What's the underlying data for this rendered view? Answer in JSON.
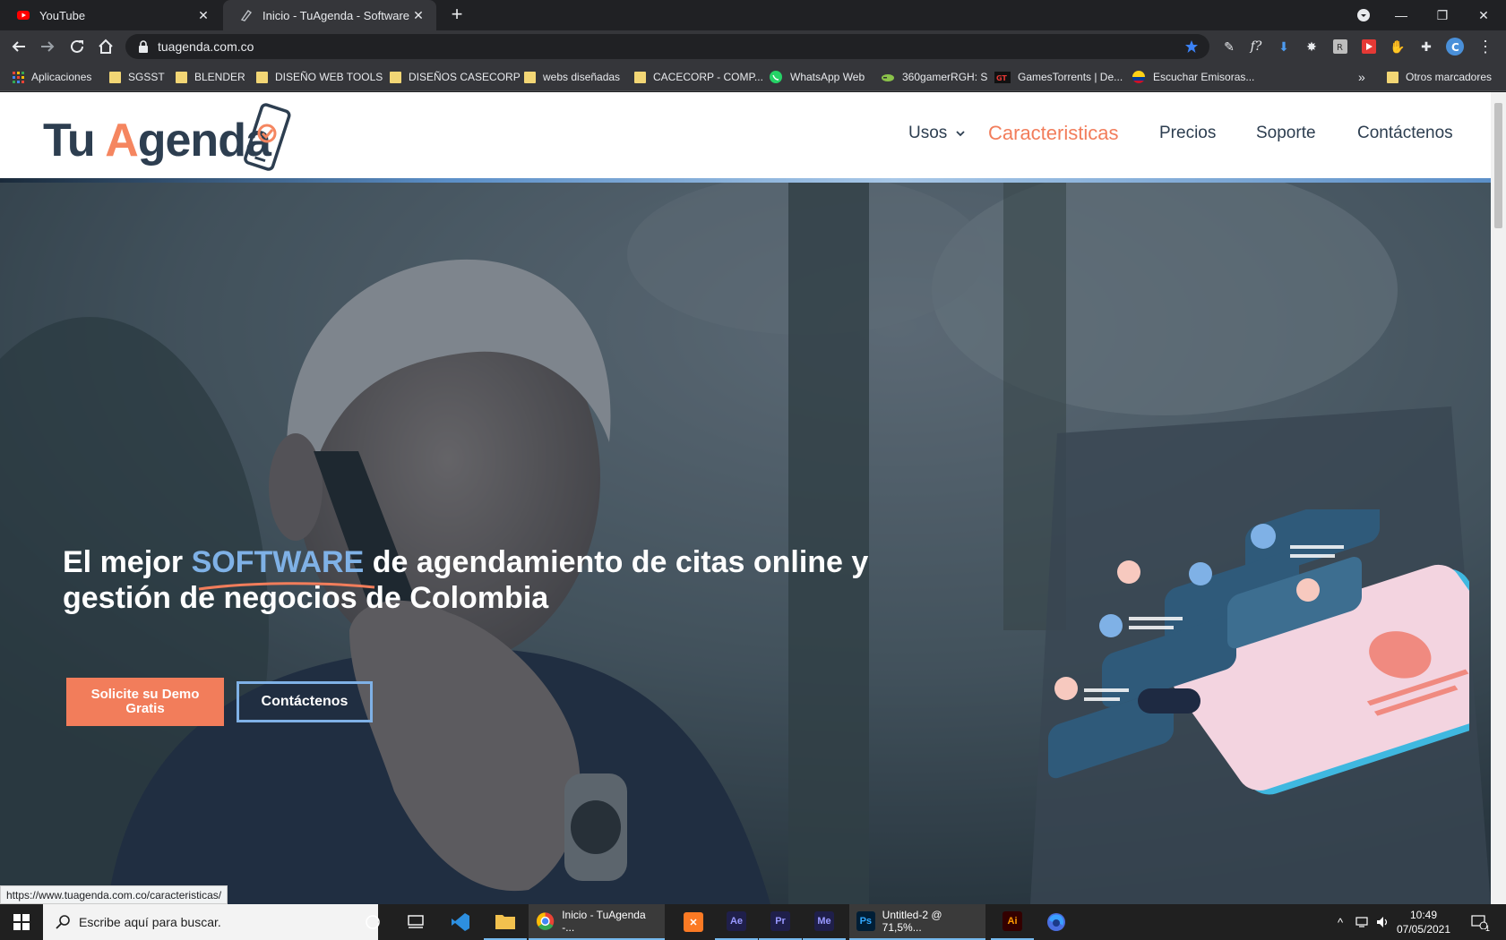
{
  "browser": {
    "tabs": [
      {
        "title": "YouTube",
        "icon": "youtube-icon"
      },
      {
        "title": "Inicio - TuAgenda - Software de ag",
        "icon": "page-icon",
        "active": true
      }
    ],
    "address": "tuagenda.com.co",
    "bookmarks": [
      {
        "label": "Aplicaciones",
        "icon": "apps-grid-icon"
      },
      {
        "label": "SGSST",
        "icon": "folder-icon"
      },
      {
        "label": "BLENDER",
        "icon": "folder-icon"
      },
      {
        "label": "DISEÑO WEB TOOLS",
        "icon": "folder-icon"
      },
      {
        "label": "DISEÑOS CASECORP",
        "icon": "folder-icon"
      },
      {
        "label": "webs diseñadas",
        "icon": "folder-icon"
      },
      {
        "label": "CACECORP - COMP...",
        "icon": "folder-icon"
      },
      {
        "label": "WhatsApp Web",
        "icon": "whatsapp-icon"
      },
      {
        "label": "360gamerRGH: S",
        "icon": "controller-icon"
      },
      {
        "label": "GamesTorrents | De...",
        "icon": "gt-icon"
      },
      {
        "label": "Escuchar Emisoras...",
        "icon": "colombia-flag-icon"
      }
    ],
    "bookmarks_overflow": "»",
    "other_bookmarks": "Otros marcadores",
    "status_url": "https://www.tuagenda.com.co/caracteristicas/"
  },
  "site": {
    "logo": {
      "part1": "Tu ",
      "part2": "A",
      "part3": "genda"
    },
    "nav": [
      {
        "label": "Usos",
        "has_dropdown": true
      },
      {
        "label": "Caracteristicas",
        "active": true
      },
      {
        "label": "Precios"
      },
      {
        "label": "Soporte"
      },
      {
        "label": "Contáctenos"
      }
    ],
    "hero": {
      "headline_pre": "El mejor ",
      "headline_highlight": "SOFTWARE",
      "headline_post": " de agendamiento de citas online y gestión de negocios de Colombia",
      "cta_primary": "Solicite su Demo Gratis",
      "cta_secondary": "Contáctenos"
    }
  },
  "taskbar": {
    "search_placeholder": "Escribe aquí para buscar.",
    "apps": [
      {
        "name": "vscode",
        "label": ""
      },
      {
        "name": "file-explorer",
        "label": ""
      },
      {
        "name": "chrome",
        "label": "Inicio - TuAgenda -..."
      },
      {
        "name": "xampp",
        "label": ""
      },
      {
        "name": "after-effects",
        "label": "Ae"
      },
      {
        "name": "premiere",
        "label": "Pr"
      },
      {
        "name": "media-encoder",
        "label": "Me"
      },
      {
        "name": "photoshop",
        "label": "Untitled-2 @ 71,5%..."
      },
      {
        "name": "illustrator",
        "label": "Ai"
      },
      {
        "name": "firefox",
        "label": ""
      }
    ],
    "time": "10:49",
    "date": "07/05/2021",
    "notifications": "1"
  },
  "colors": {
    "accent_orange": "#f27d5b",
    "accent_blue": "#7fb1e6",
    "navy": "#2d3e50"
  }
}
